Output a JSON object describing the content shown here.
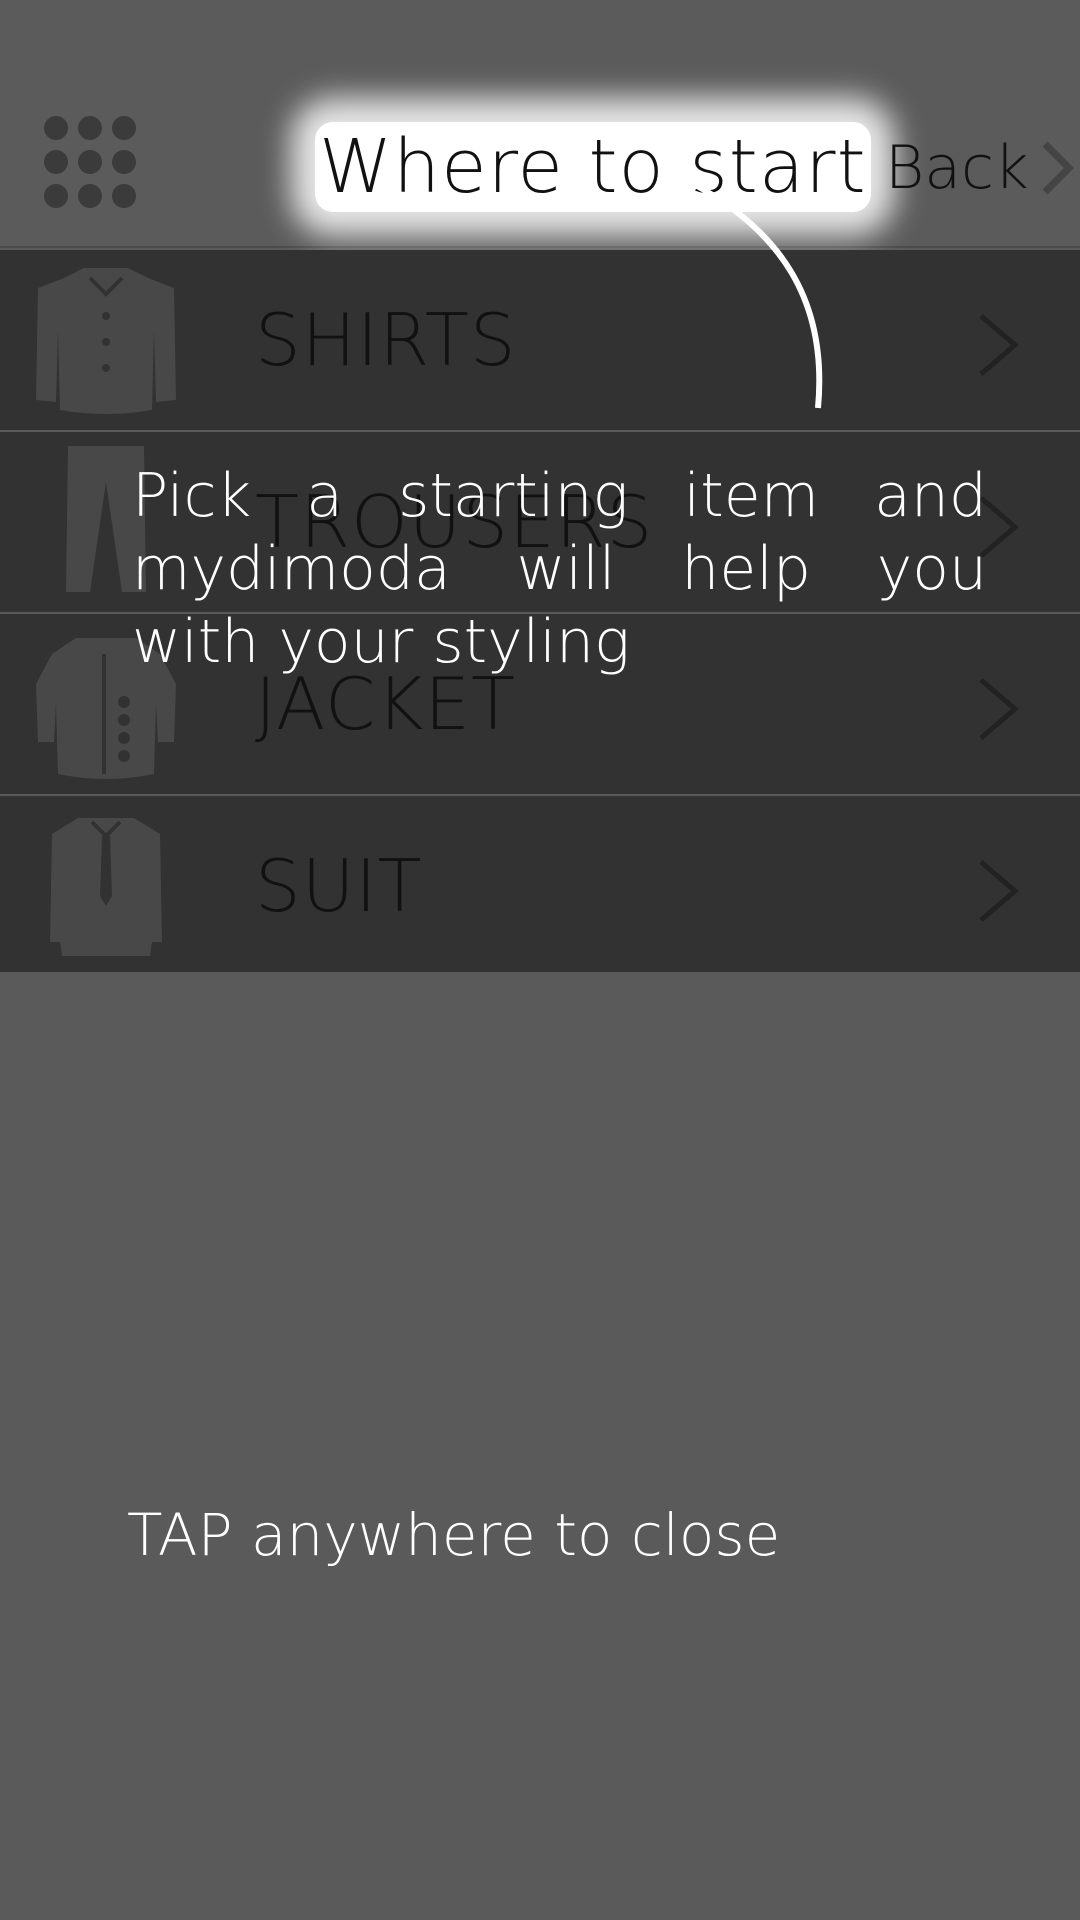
{
  "header": {
    "title": "Where to start",
    "back_label": "Back",
    "menu_icon": "grid-menu-icon",
    "back_icon": "chevron-right-icon"
  },
  "list": {
    "items": [
      {
        "label": "SHIRTS",
        "icon": "shirt-icon"
      },
      {
        "label": "TROUSERS",
        "icon": "trousers-icon"
      },
      {
        "label": "JACKET",
        "icon": "jacket-icon"
      },
      {
        "label": "SUIT",
        "icon": "suit-icon"
      }
    ]
  },
  "overlay": {
    "tip": "Pick a starting item and mydimoda will help you with your styling",
    "close_hint": "TAP anywhere to close"
  },
  "colors": {
    "background": "#5a5a5a",
    "list_row": "#323232",
    "title_highlight": "#ffffff",
    "overlay_text": "#ffffff"
  }
}
